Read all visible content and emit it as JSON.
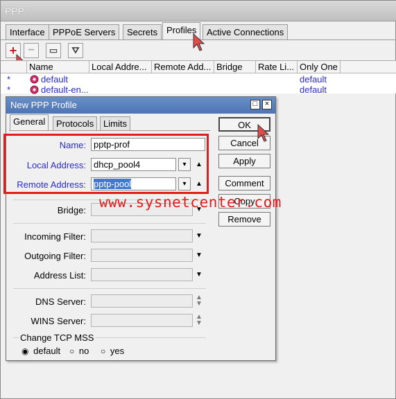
{
  "window": {
    "title": "PPP"
  },
  "tabs": [
    "Interface",
    "PPPoE Servers",
    "Secrets",
    "Profiles",
    "Active Connections"
  ],
  "toolbar": {
    "add_glyph": "+",
    "remove_glyph": "−",
    "comment_glyph": "▭",
    "filter_glyph": "⛛"
  },
  "list": {
    "columns": [
      "Name",
      "Local Addre...",
      "Remote Add...",
      "Bridge",
      "Rate Li...",
      "Only One"
    ],
    "rows": [
      {
        "flag": "*",
        "name": "default",
        "only_one": "default"
      },
      {
        "flag": "*",
        "name": "default-en...",
        "only_one": "default"
      }
    ]
  },
  "dialog": {
    "title": "New PPP Profile",
    "tabs": [
      "General",
      "Protocols",
      "Limits"
    ],
    "fields": {
      "name_label": "Name:",
      "name_value": "pptp-prof",
      "local_label": "Local Address:",
      "local_value": "dhcp_pool4",
      "remote_label": "Remote Address:",
      "remote_value": "pptp-pool",
      "bridge_label": "Bridge:",
      "incoming_label": "Incoming Filter:",
      "outgoing_label": "Outgoing Filter:",
      "address_list_label": "Address List:",
      "dns_label": "DNS Server:",
      "wins_label": "WINS Server:"
    },
    "tcp_mss": {
      "label": "Change TCP MSS",
      "options": [
        "default",
        "no",
        "yes"
      ],
      "selected": "default"
    },
    "buttons": {
      "ok": "OK",
      "cancel": "Cancel",
      "apply": "Apply",
      "comment": "Comment",
      "copy": "Copy",
      "remove": "Remove"
    }
  },
  "watermark": "www.sysnetcenter.com",
  "colors": {
    "highlight": "#e21b1b",
    "title_bar": "#4d74b4",
    "link_text": "#2a2ac8"
  }
}
